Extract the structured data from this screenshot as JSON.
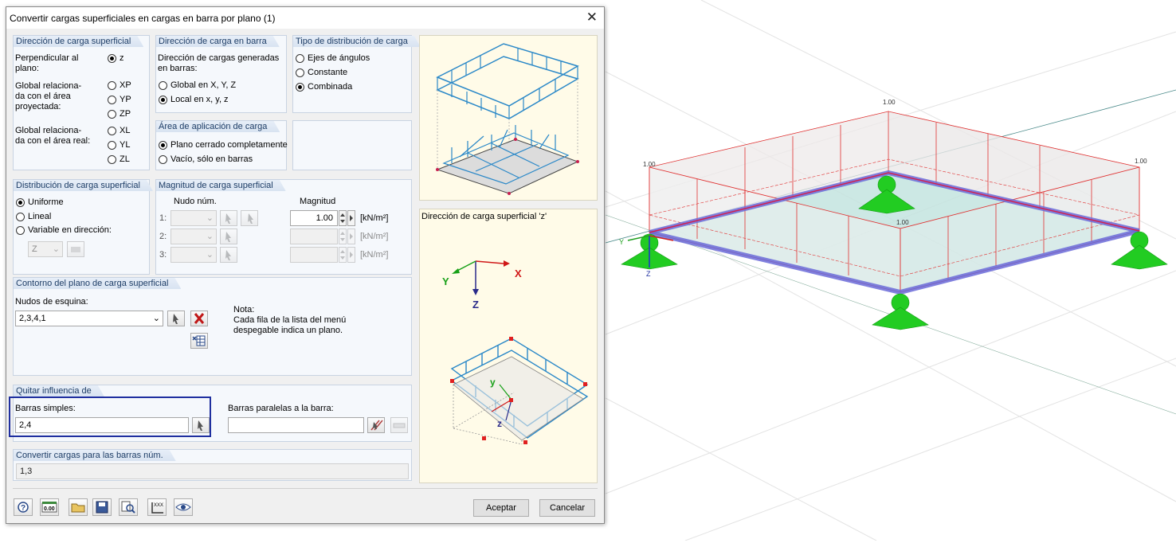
{
  "dialog": {
    "title": "Convertir cargas superficiales en cargas en barra por plano   (1)",
    "close_glyph": "✕",
    "surface_dir": {
      "header": "Dirección de carga superficial",
      "perp_label": "Perpendicular al\nplano:",
      "perp_option": "z",
      "global_proj_label": "Global relaciona-\nda con el área\nproyectada:",
      "proj_options": [
        "XP",
        "YP",
        "ZP"
      ],
      "global_real_label": "Global relaciona-\nda con el área real:",
      "real_options": [
        "XL",
        "YL",
        "ZL"
      ]
    },
    "member_dir": {
      "header": "Dirección de carga en barra",
      "desc": "Dirección de cargas generadas\nen barras:",
      "opt_global": "Global en X, Y, Z",
      "opt_local": "Local en x, y, z"
    },
    "dist_type": {
      "header": "Tipo de distribución de carga",
      "options": [
        "Ejes de ángulos",
        "Constante",
        "Combinada"
      ]
    },
    "area": {
      "header": "Área de aplicación de carga",
      "opt_closed": "Plano cerrado completamente",
      "opt_void": "Vacío, sólo en barras"
    },
    "surface_dist": {
      "header": "Distribución de carga superficial",
      "options": [
        "Uniforme",
        "Lineal",
        "Variable en dirección:"
      ],
      "dir_value": "Z"
    },
    "magnitude": {
      "header": "Magnitud de carga superficial",
      "col_node": "Nudo núm.",
      "col_mag": "Magnitud",
      "rows": [
        {
          "label": "1:",
          "value": "1.00",
          "unit": "[kN/m²]"
        },
        {
          "label": "2:",
          "value": "",
          "unit": "[kN/m²]"
        },
        {
          "label": "3:",
          "value": "",
          "unit": "[kN/m²]"
        }
      ]
    },
    "contour": {
      "header": "Contorno del plano de carga superficial",
      "corner_label": "Nudos de esquina:",
      "corner_value": "2,3,4,1",
      "note_title": "Nota:",
      "note_text": "Cada fila de la lista del menú\ndespegable indica un plano."
    },
    "remove": {
      "header": "Quitar influencia de",
      "single_label": "Barras simples:",
      "single_value": "2,4",
      "parallel_label": "Barras paralelas a la barra:",
      "parallel_value": ""
    },
    "convert": {
      "header": "Convertir cargas para las barras núm.",
      "value": "1,3"
    },
    "preview": {
      "caption": "Dirección de carga superficial 'z'",
      "axis_x": "X",
      "axis_y": "Y",
      "axis_z": "Z",
      "local_y": "y",
      "local_z": "z"
    },
    "buttons": {
      "ok": "Aceptar",
      "cancel": "Cancelar",
      "units_icon_text": "0.00"
    }
  },
  "model_view": {
    "load_labels": [
      "1.00",
      "1.00",
      "1.00",
      "1.00"
    ],
    "axis_y": "Y",
    "axis_z": "Z"
  },
  "colors": {
    "accent_dark_blue": "#1d3d66",
    "load_red": "#e03030",
    "support_green": "#22cc22",
    "member_blue": "#6a6ad8",
    "highlight_frame": "#1f2f9f"
  }
}
